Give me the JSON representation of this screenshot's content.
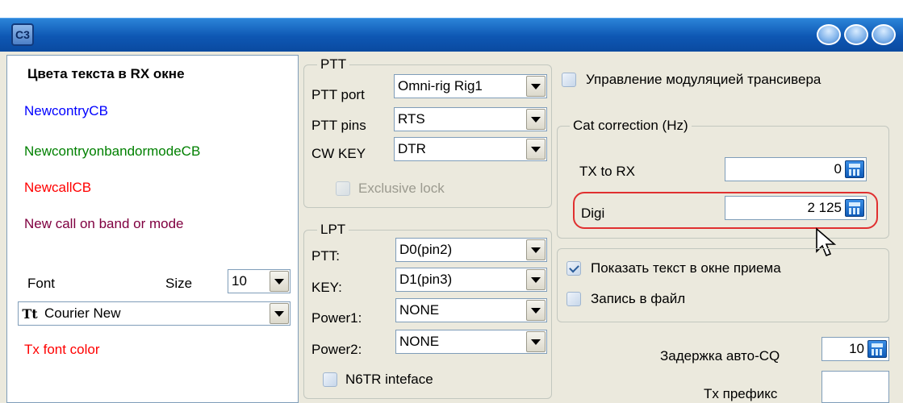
{
  "window": {
    "app_icon_glyph": "C3"
  },
  "rx_colors": {
    "heading": "Цвета текста в RX окне",
    "new_country": "NewcontryCB",
    "new_country_band_mode": "NewcontryonbandormodeCB",
    "new_call": "NewcallCB",
    "new_call_band_mode": "New call on band or mode",
    "colors": {
      "new_country": "#0000ff",
      "new_country_band_mode": "#008000",
      "new_call": "#ff0000",
      "new_call_band_mode": "#800040",
      "tx_font": "#ff0000"
    }
  },
  "font": {
    "label": "Font",
    "size_label": "Size",
    "size_value": "10",
    "font_value": "Courier New",
    "font_icon": "truetype-icon",
    "tx_font_color": "Tx font color"
  },
  "ptt": {
    "legend": "PTT",
    "port_label": "PTT port",
    "port_value": "Omni-rig Rig1",
    "pins_label": "PTT pins",
    "pins_value": "RTS",
    "cw_label": "CW KEY",
    "cw_value": "DTR",
    "exclusive_label": "Exclusive lock",
    "exclusive_checked": false
  },
  "lpt": {
    "legend": "LPT",
    "ptt_label": "PTT:",
    "ptt_value": "D0(pin2)",
    "key_label": "KEY:",
    "key_value": "D1(pin3)",
    "power1_label": "Power1:",
    "power1_value": "NONE",
    "power2_label": "Power2:",
    "power2_value": "NONE",
    "n6tr_label": "N6TR inteface",
    "n6tr_checked": false
  },
  "modulation": {
    "label": "Управление модуляцией трансивера",
    "checked": false
  },
  "cat": {
    "legend": "Cat correction (Hz)",
    "tx_rx_label": "TX to RX",
    "tx_rx_value": "0",
    "digi_label": "Digi",
    "digi_value": "2 125",
    "highlight_color": "#e03030"
  },
  "rx_options": {
    "show_text_label": "Показать текст в окне приема",
    "show_text_checked": true,
    "write_file_label": "Запись в файл",
    "write_file_checked": false
  },
  "auto_cq": {
    "label": "Задержка авто-CQ",
    "value": "10"
  },
  "tx_prefix": {
    "label": "Tx префикс",
    "value": ""
  }
}
